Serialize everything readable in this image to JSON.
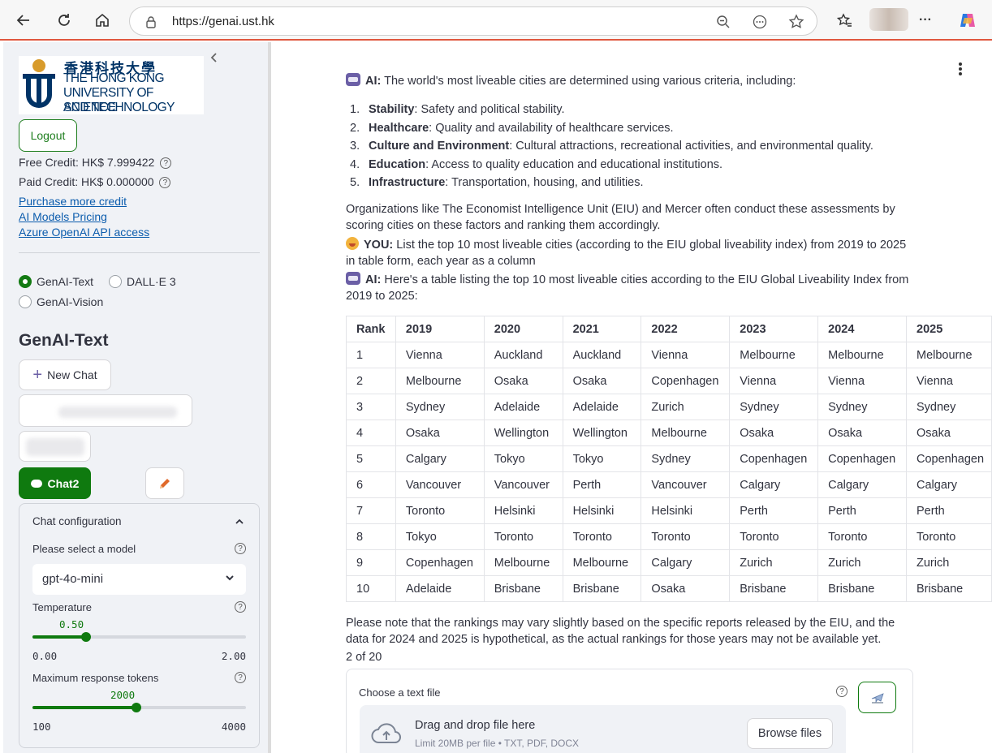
{
  "browser": {
    "url": "https://genai.ust.hk",
    "more_label": "···"
  },
  "sidebar": {
    "logo": {
      "zh": "香港科技大學",
      "en_line1": "THE HONG KONG",
      "en_line2": "UNIVERSITY OF SCIENCE",
      "en_line3": "AND TECHNOLOGY"
    },
    "logout_label": "Logout",
    "free_credit": "Free Credit: HK$ 7.999422",
    "paid_credit": "Paid Credit: HK$ 0.000000",
    "links": [
      "Purchase more credit",
      "AI Models Pricing",
      "Azure OpenAI API access"
    ],
    "modes": [
      {
        "label": "GenAI-Text",
        "checked": true
      },
      {
        "label": "DALL·E 3",
        "checked": false
      },
      {
        "label": "GenAI-Vision",
        "checked": false
      }
    ],
    "section_title": "GenAI-Text",
    "new_chat_label": "New Chat",
    "active_chat_label": "Chat2",
    "config": {
      "title": "Chat configuration",
      "model_label": "Please select a model",
      "model_value": "gpt-4o-mini",
      "temperature": {
        "label": "Temperature",
        "value": "0.50",
        "min": "0.00",
        "max": "2.00",
        "fraction": 0.25
      },
      "max_tokens": {
        "label": "Maximum response tokens",
        "value": "2000",
        "min": "100",
        "max": "4000",
        "fraction": 0.487
      }
    }
  },
  "chat": {
    "ai_label": "AI:",
    "you_label": "YOU:",
    "msg1": "The world's most liveable cities are determined using various criteria, including:",
    "criteria": [
      {
        "num": "1.",
        "term": "Stability",
        "desc": ": Safety and political stability."
      },
      {
        "num": "2.",
        "term": "Healthcare",
        "desc": ": Quality and availability of healthcare services."
      },
      {
        "num": "3.",
        "term": "Culture and Environment",
        "desc": ": Cultural attractions, recreational activities, and environmental quality."
      },
      {
        "num": "4.",
        "term": "Education",
        "desc": ": Access to quality education and educational institutions."
      },
      {
        "num": "5.",
        "term": "Infrastructure",
        "desc": ": Transportation, housing, and utilities."
      }
    ],
    "org_text": "Organizations like The Economist Intelligence Unit (EIU) and Mercer often conduct these assessments by scoring cities on these factors and ranking them accordingly.",
    "you_text": "List the top 10 most liveable cities (according to the EIU global liveability index) from 2019 to 2025 in table form, each year as a column",
    "ai_text2": "Here's a table listing the top 10 most liveable cities according to the EIU Global Liveability Index from 2019 to 2025:",
    "table": {
      "headers": [
        "Rank",
        "2019",
        "2020",
        "2021",
        "2022",
        "2023",
        "2024",
        "2025"
      ],
      "rows": [
        [
          "1",
          "Vienna",
          "Auckland",
          "Auckland",
          "Vienna",
          "Melbourne",
          "Melbourne",
          "Melbourne"
        ],
        [
          "2",
          "Melbourne",
          "Osaka",
          "Osaka",
          "Copenhagen",
          "Vienna",
          "Vienna",
          "Vienna"
        ],
        [
          "3",
          "Sydney",
          "Adelaide",
          "Adelaide",
          "Zurich",
          "Sydney",
          "Sydney",
          "Sydney"
        ],
        [
          "4",
          "Osaka",
          "Wellington",
          "Wellington",
          "Melbourne",
          "Osaka",
          "Osaka",
          "Osaka"
        ],
        [
          "5",
          "Calgary",
          "Tokyo",
          "Tokyo",
          "Sydney",
          "Copenhagen",
          "Copenhagen",
          "Copenhagen"
        ],
        [
          "6",
          "Vancouver",
          "Vancouver",
          "Perth",
          "Vancouver",
          "Calgary",
          "Calgary",
          "Calgary"
        ],
        [
          "7",
          "Toronto",
          "Helsinki",
          "Helsinki",
          "Helsinki",
          "Perth",
          "Perth",
          "Perth"
        ],
        [
          "8",
          "Tokyo",
          "Toronto",
          "Toronto",
          "Toronto",
          "Toronto",
          "Toronto",
          "Toronto"
        ],
        [
          "9",
          "Copenhagen",
          "Melbourne",
          "Melbourne",
          "Calgary",
          "Zurich",
          "Zurich",
          "Zurich"
        ],
        [
          "10",
          "Adelaide",
          "Brisbane",
          "Brisbane",
          "Osaka",
          "Brisbane",
          "Brisbane",
          "Brisbane"
        ]
      ]
    },
    "note": "Please note that the rankings may vary slightly based on the specific reports released by the EIU, and the data for 2024 and 2025 is hypothetical, as the actual rankings for those years may not be available yet.",
    "pager": "2 of 20"
  },
  "upload": {
    "label": "Choose a text file",
    "drag_text": "Drag and drop file here",
    "limit_text": "Limit 20MB per file • TXT, PDF, DOCX",
    "browse_label": "Browse files"
  },
  "colors": {
    "accent_green": "#0f7a0f",
    "link_blue": "#0b5cad",
    "sidebar_bg": "#f0f2f6"
  }
}
